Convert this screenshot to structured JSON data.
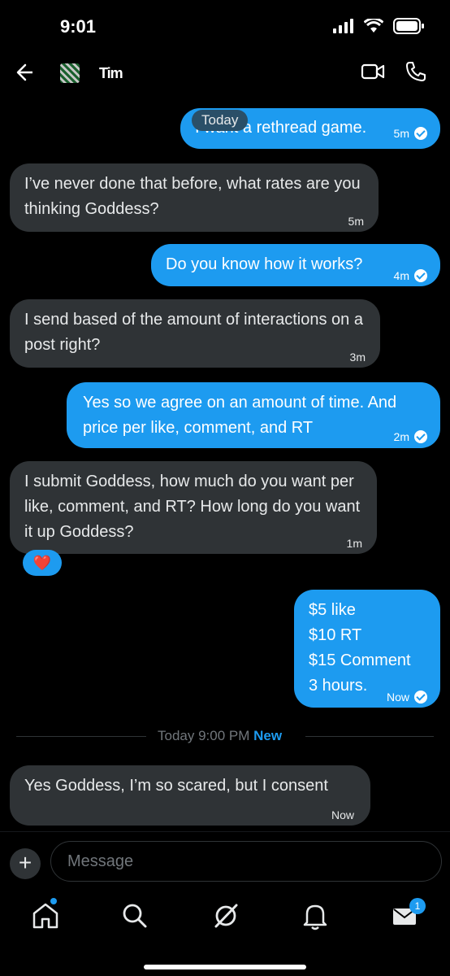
{
  "status": {
    "time": "9:01"
  },
  "header": {
    "contact_name": "Tim"
  },
  "day_label": "Today",
  "messages": [
    {
      "dir": "out",
      "text": "I want a rethread game.",
      "time": "5m"
    },
    {
      "dir": "in",
      "text": "I’ve never done that before, what rates are you thinking Goddess?",
      "time": "5m"
    },
    {
      "dir": "out",
      "text": "Do you know how it works?",
      "time": "4m"
    },
    {
      "dir": "in",
      "text": "I send based of the amount of interactions on a post right?",
      "time": "3m"
    },
    {
      "dir": "out",
      "text": "Yes so we agree on an amount of time. And price per like, comment, and RT",
      "time": "2m"
    },
    {
      "dir": "in",
      "text": "I submit Goddess, how much do you want per like, comment, and RT? How long do you want it up Goddess?",
      "time": "1m"
    },
    {
      "dir": "out",
      "lines": [
        "$5 like",
        "$10 RT",
        "$15 Comment",
        "3 hours."
      ],
      "time": "Now"
    },
    {
      "dir": "in",
      "text": "Yes Goddess, I’m so scared, but I consent",
      "time": "Now"
    }
  ],
  "reaction": {
    "emoji": "❤️"
  },
  "divider": {
    "text": "Today 9:00 PM",
    "new_label": "New"
  },
  "composer": {
    "placeholder": "Message",
    "plus": "+"
  },
  "tabs": {
    "messages_badge": "1"
  },
  "colors": {
    "accent": "#1d9bf0",
    "bubble_in": "#2f3336",
    "background": "#000000"
  },
  "icons": [
    "back-arrow-icon",
    "video-call-icon",
    "phone-icon",
    "home-icon",
    "search-icon",
    "grok-icon",
    "bell-icon",
    "mail-icon"
  ]
}
